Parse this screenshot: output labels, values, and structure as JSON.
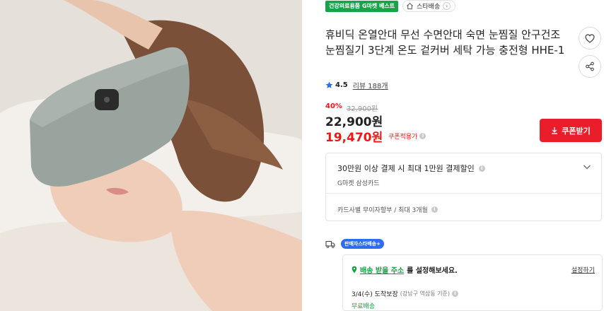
{
  "product": {
    "category_badge": "건강의료용품 G마켓 베스트",
    "seller_badge": "스타배송",
    "title": "휴비딕 온열안대 무선 수면안대 숙면 눈찜질 안구건조 눈찜질기 3단계 온도 겉커버 세탁 가능 충전형 HHE-1",
    "rating": "4.5",
    "reviews_label": "리뷰 188개"
  },
  "price": {
    "discount_rate": "40%",
    "original": "32,900원",
    "sale": "22,900원",
    "coupon_price": "19,470원",
    "coupon_label": "쿠폰적용가",
    "coupon_button": "쿠폰받기"
  },
  "card_offer": {
    "title": "30만원 이상 결제 시 최대 1만원 결제할인",
    "card": "G마켓 삼성카드",
    "installment": "카드사별 무이자할부 / 최대 3개월"
  },
  "delivery": {
    "badge": "판매자스타배송+",
    "address_link": "배송 받을 주소",
    "address_rest": "를 설정해보세요.",
    "settings_link": "설정하기",
    "arrival": "3/4(수) 도착보장",
    "arrival_sub": "(강남구 역삼동 기준)",
    "free_shipping": "무료배송"
  },
  "icons": {
    "wishlist": "heart-icon",
    "share": "share-icon",
    "home": "home-icon",
    "star": "star-icon",
    "download": "download-icon",
    "chevron": "chevron-down-icon",
    "truck": "truck-icon",
    "location": "location-pin-icon",
    "info": "info-icon"
  },
  "colors": {
    "accent_red": "#e91e2a",
    "badge_green": "#18a34a",
    "badge_blue": "#2d6df6",
    "star_blue": "#2d6df6"
  }
}
